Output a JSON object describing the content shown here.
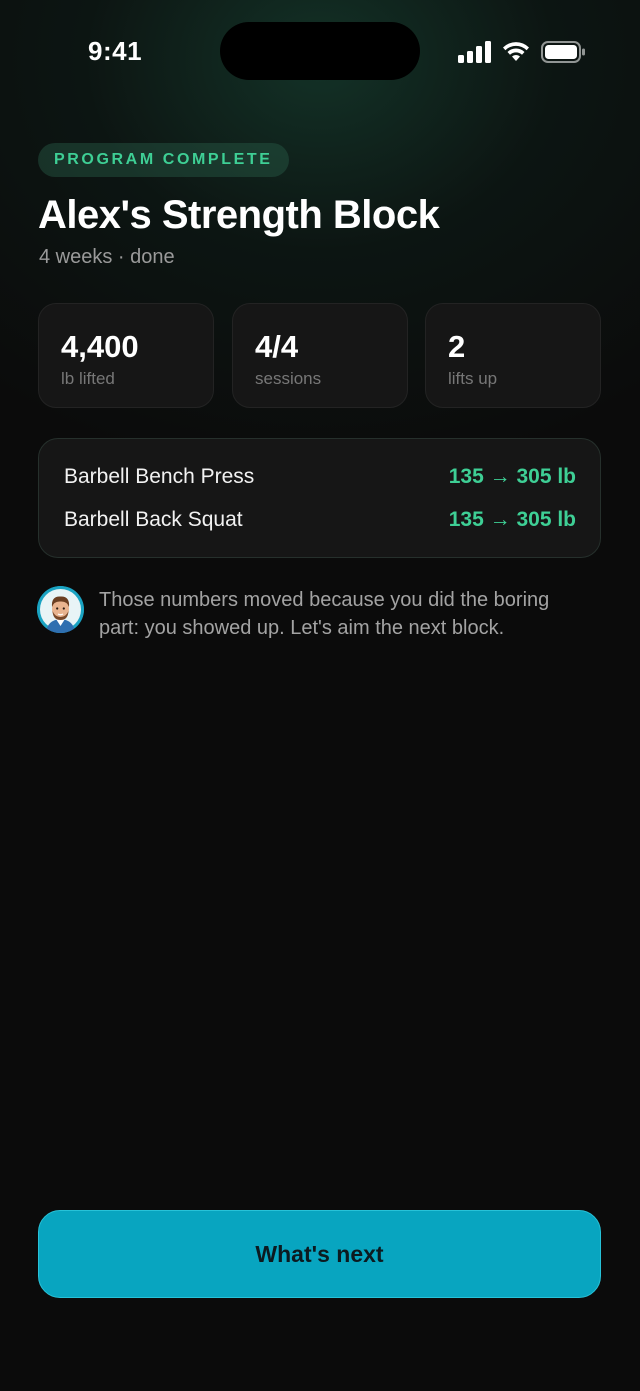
{
  "status_bar": {
    "time": "9:41",
    "icons": [
      "cellular-signal-icon",
      "wifi-icon",
      "battery-icon"
    ]
  },
  "header": {
    "badge": "PROGRAM COMPLETE",
    "title": "Alex's Strength Block",
    "subtitle": "4 weeks · done"
  },
  "stats": [
    {
      "value": "4,400",
      "label": "lb lifted"
    },
    {
      "value": "4/4",
      "label": "sessions"
    },
    {
      "value": "2",
      "label": "lifts up"
    }
  ],
  "lifts": [
    {
      "name": "Barbell Bench Press",
      "progress": "135 → 305 lb"
    },
    {
      "name": "Barbell Back Squat",
      "progress": "135 → 305 lb"
    }
  ],
  "coach": {
    "avatar_icon": "coach-avatar-icon",
    "message": "Those numbers moved because you did the boring part: you showed up. Let's aim the next block."
  },
  "cta": {
    "label": "What's next"
  },
  "colors": {
    "background": "#0b0b0b",
    "accent_green": "#3ecf95",
    "cta_blue": "#08a5c0",
    "card": "#161616"
  }
}
